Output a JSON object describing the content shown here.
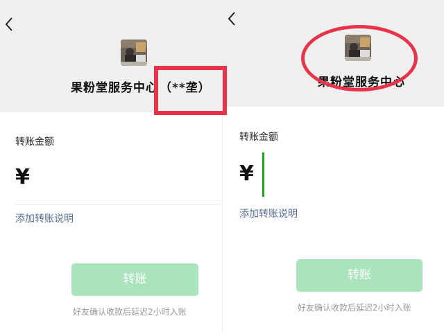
{
  "colors": {
    "header_bg": "#efefef",
    "annotation_red": "#e8334a",
    "link_blue": "#576b95",
    "button_disabled_green": "#a9e4bd",
    "caret_green": "#1aad19"
  },
  "left": {
    "back_icon": "chevron-left-icon",
    "avatar_icon": "merchant-avatar",
    "merchant_name": "果粉堂服务中心",
    "masked_real_name": "（**垄）",
    "amount_label": "转账金额",
    "currency_symbol": "¥",
    "amount_value": "",
    "add_note_link": "添加转账说明",
    "transfer_button": "转账",
    "delay_note": "好友确认收款后延迟2小时入账"
  },
  "right": {
    "back_icon": "chevron-left-icon",
    "avatar_icon": "merchant-avatar",
    "merchant_name": "果粉堂服务中心",
    "amount_label": "转账金额",
    "currency_symbol": "¥",
    "amount_value": "",
    "add_note_link": "添加转账说明",
    "transfer_button": "转账",
    "delay_note": "好友确认收款后延迟2小时入账"
  }
}
